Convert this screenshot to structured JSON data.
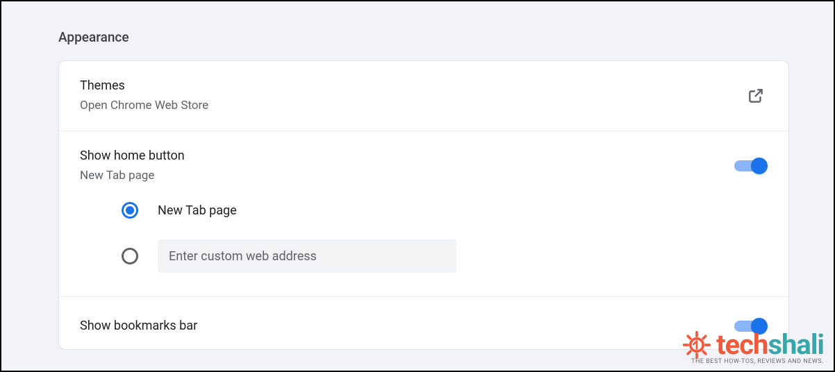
{
  "section": {
    "title": "Appearance"
  },
  "themes": {
    "title": "Themes",
    "subtitle": "Open Chrome Web Store"
  },
  "home_button": {
    "title": "Show home button",
    "subtitle": "New Tab page",
    "enabled": true,
    "options": {
      "new_tab_label": "New Tab page",
      "custom_placeholder": "Enter custom web address",
      "selected": "new_tab"
    }
  },
  "bookmarks_bar": {
    "title": "Show bookmarks bar",
    "enabled": true
  },
  "watermark": {
    "brand_part1": "tech",
    "brand_part2": "shali",
    "tagline": "THE BEST HOW-TOS, REVIEWS AND NEWS."
  }
}
